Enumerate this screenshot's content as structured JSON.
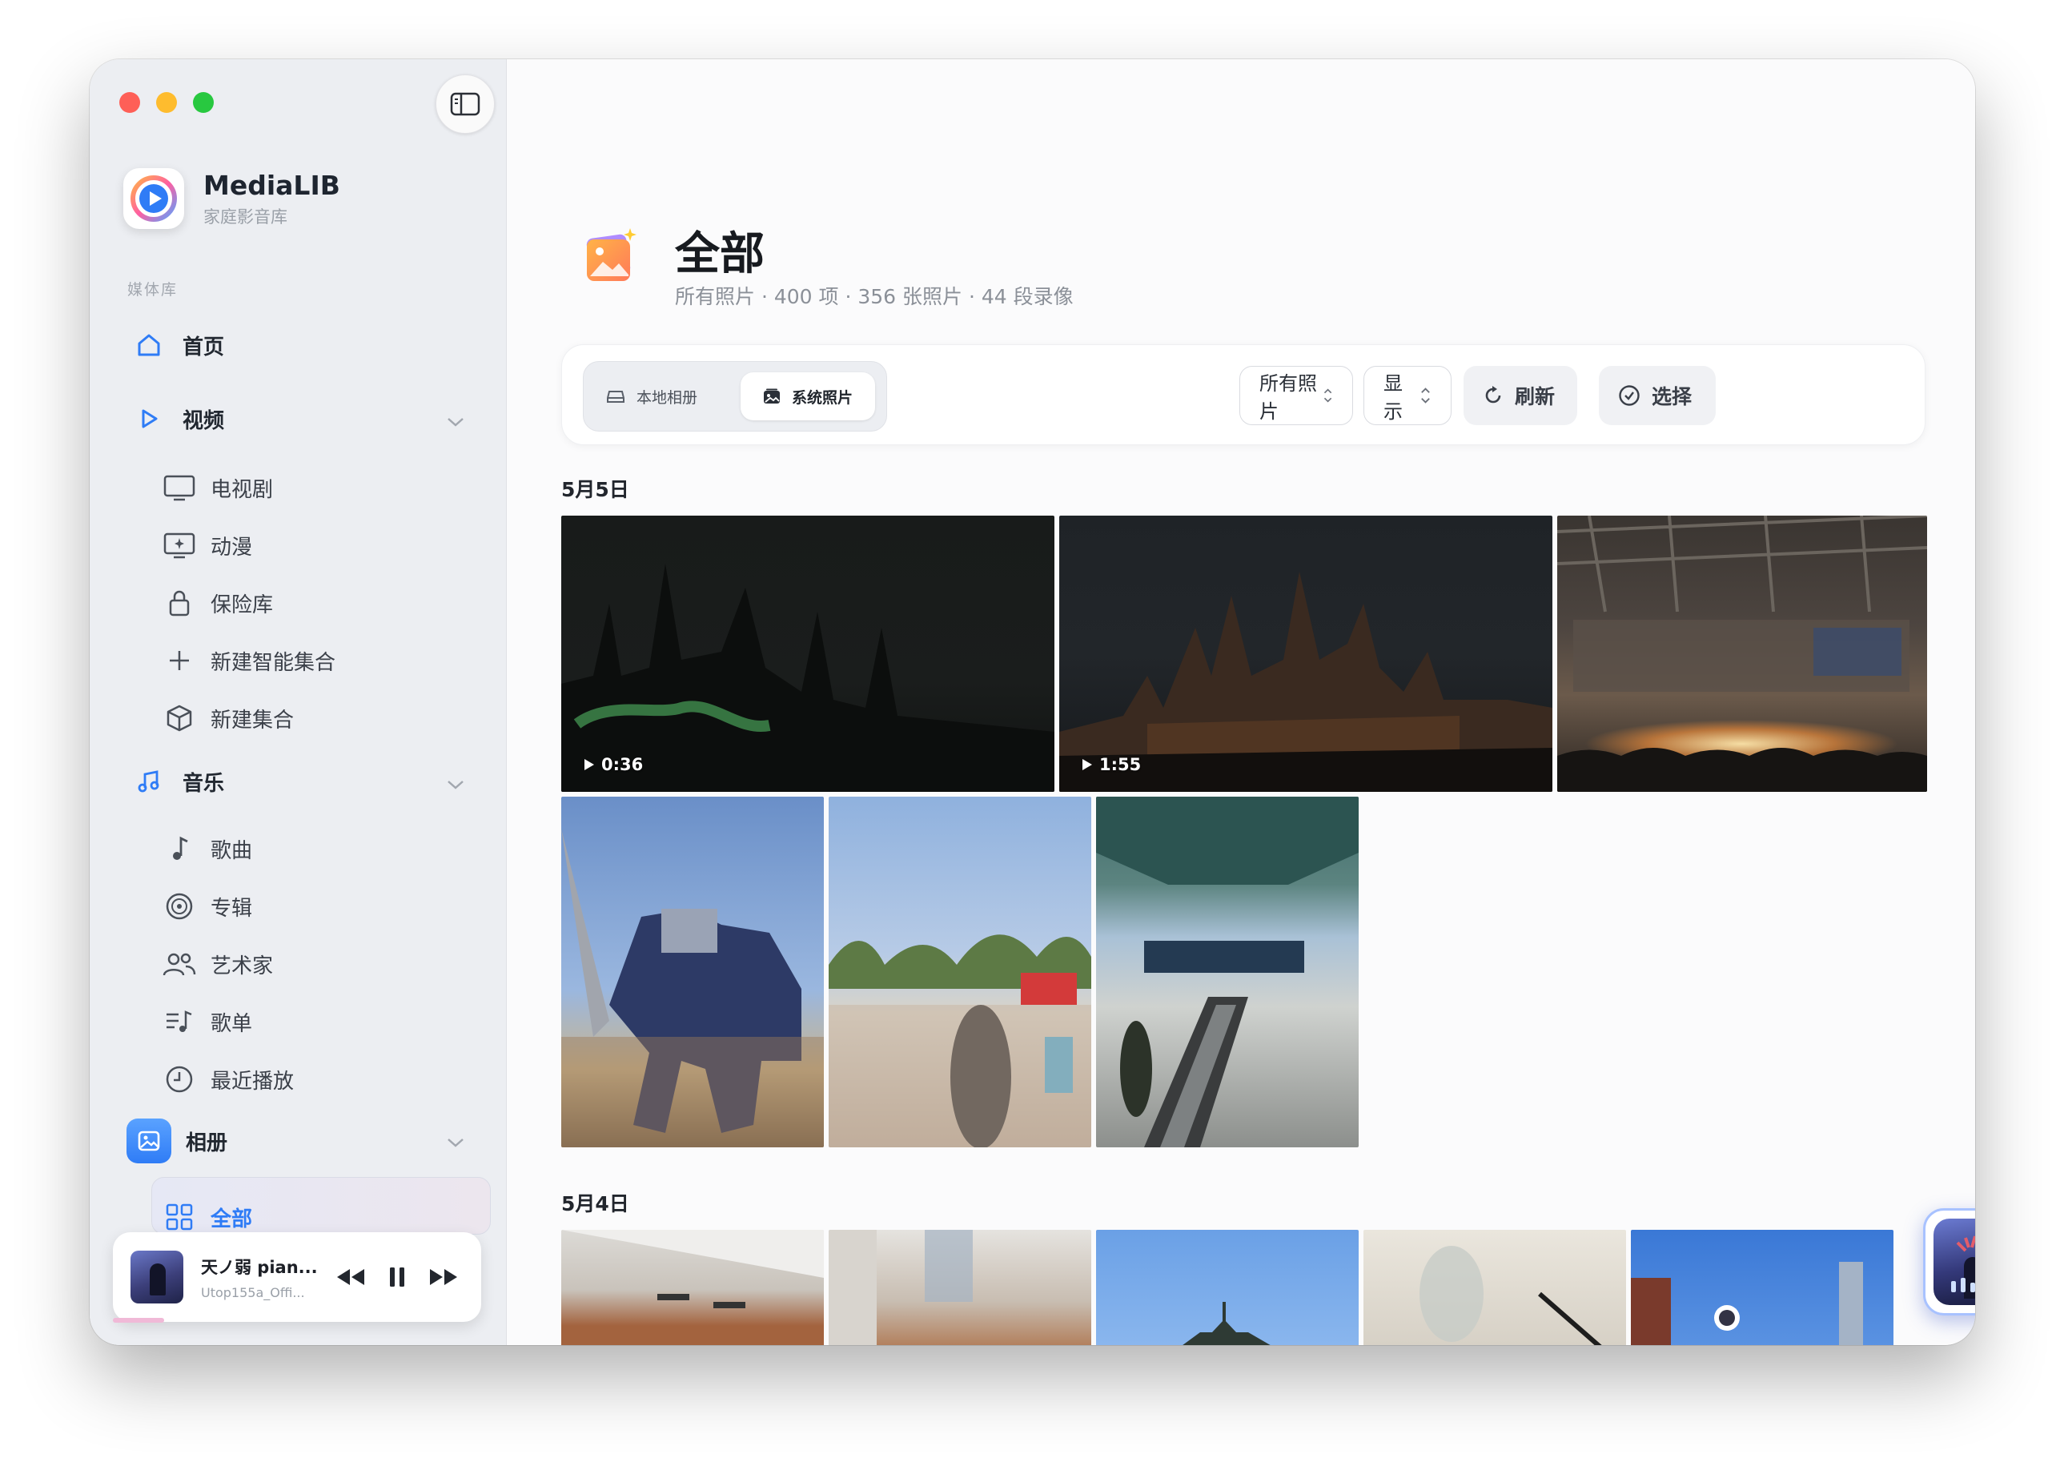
{
  "app": {
    "name": "MediaLIB",
    "subtitle": "家庭影音库"
  },
  "sidebar": {
    "section_label": "媒体库",
    "home": "首页",
    "video": {
      "label": "视频",
      "items": [
        "电视剧",
        "动漫",
        "保险库",
        "新建智能集合",
        "新建集合"
      ]
    },
    "music": {
      "label": "音乐",
      "items": [
        "歌曲",
        "专辑",
        "艺术家",
        "歌单",
        "最近播放"
      ]
    },
    "album": {
      "label": "相册",
      "items": [
        "全部"
      ]
    }
  },
  "player": {
    "title": "天ノ弱 pian...",
    "artist": "Utop155a_Offi..."
  },
  "page": {
    "title": "全部",
    "subtitle": "所有照片 · 400 项 · 356 张照片 · 44 段录像"
  },
  "toolbar": {
    "seg_local": "本地相册",
    "seg_system": "系统照片",
    "filter_select": "所有照片",
    "display_select": "显示",
    "refresh": "刷新",
    "select": "选择"
  },
  "groups": [
    {
      "date": "5月5日",
      "video_durations": [
        "0:36",
        "1:55"
      ]
    },
    {
      "date": "5月4日"
    }
  ],
  "colors": {
    "accent": "#2f7cf6",
    "sidebar_bg": "#eceef2"
  }
}
